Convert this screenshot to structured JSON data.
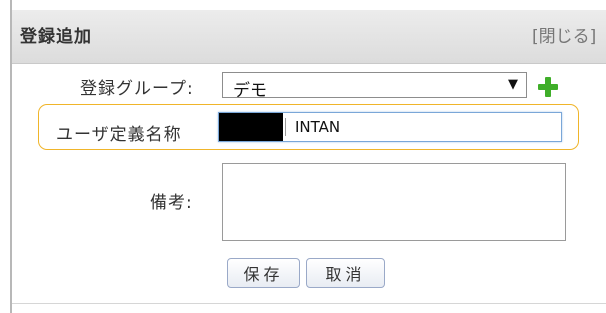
{
  "dialog": {
    "title": "登録追加",
    "close_label": "[閉じる]"
  },
  "form": {
    "group_label": "登録グループ:",
    "group_value": "デモ",
    "group_arrow": "▼",
    "name_label": "ユーザ定義名称",
    "name_value": "INTAN",
    "remarks_label": "備考:",
    "remarks_value": ""
  },
  "buttons": {
    "save_label": "保存",
    "cancel_label": "取消"
  },
  "colors": {
    "accent_highlight": "#f0b52a",
    "add_icon": "#3fae29",
    "input_focus_border": "#7aa7d8"
  },
  "icons": {
    "add_group": "plus-icon",
    "dropdown": "chevron-down-icon"
  }
}
